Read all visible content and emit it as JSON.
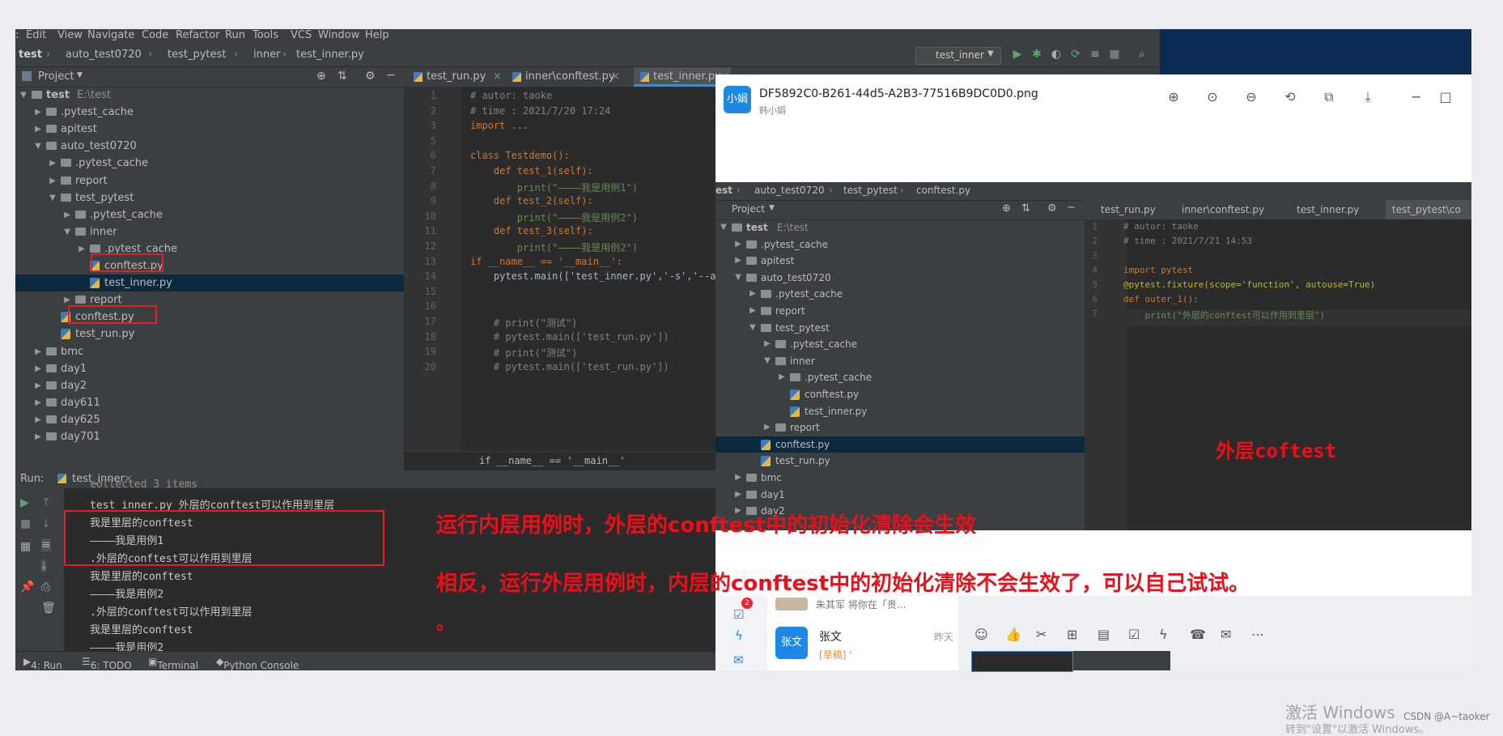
{
  "menu": [
    "Edit",
    "View",
    "Navigate",
    "Code",
    "Refactor",
    "Run",
    "Tools",
    "VCS",
    "Window",
    "Help"
  ],
  "breadcrumb": [
    "test",
    "auto_test0720",
    "test_pytest",
    "inner",
    "test_inner.py"
  ],
  "run_config": "test_inner",
  "project_header": "Project",
  "tree": [
    {
      "label": "test",
      "path": "E:\\test",
      "type": "root"
    },
    {
      "label": ".pytest_cache",
      "type": "folder"
    },
    {
      "label": "apitest",
      "type": "folder"
    },
    {
      "label": "auto_test0720",
      "type": "folder"
    },
    {
      "label": ".pytest_cache",
      "type": "folder"
    },
    {
      "label": "report",
      "type": "folder"
    },
    {
      "label": "test_pytest",
      "type": "folder"
    },
    {
      "label": ".pytest_cache",
      "type": "folder"
    },
    {
      "label": "inner",
      "type": "folder"
    },
    {
      "label": ".pytest_cache",
      "type": "folder"
    },
    {
      "label": "conftest.py",
      "type": "py"
    },
    {
      "label": "test_inner.py",
      "type": "py"
    },
    {
      "label": "report",
      "type": "folder"
    },
    {
      "label": "conftest.py",
      "type": "py"
    },
    {
      "label": "test_run.py",
      "type": "py"
    },
    {
      "label": "bmc",
      "type": "folder"
    },
    {
      "label": "day1",
      "type": "folder"
    },
    {
      "label": "day2",
      "type": "folder"
    },
    {
      "label": "day611",
      "type": "folder"
    },
    {
      "label": "day625",
      "type": "folder"
    },
    {
      "label": "day701",
      "type": "folder"
    }
  ],
  "editor_tabs": [
    "test_run.py",
    "inner\\conftest.py",
    "test_inner.py"
  ],
  "code_lines": [
    {
      "n": "1",
      "t": "# autor: taoke"
    },
    {
      "n": "2",
      "t": "# time : 2021/7/20 17:24"
    },
    {
      "n": "3",
      "t": "import ..."
    },
    {
      "n": "5",
      "t": ""
    },
    {
      "n": "6",
      "t": "class Testdemo():"
    },
    {
      "n": "7",
      "t": "    def test_1(self):"
    },
    {
      "n": "8",
      "t": "        print(\"————我是用例1\")"
    },
    {
      "n": "9",
      "t": "    def test_2(self):"
    },
    {
      "n": "10",
      "t": "        print(\"————我是用例2\")"
    },
    {
      "n": "11",
      "t": "    def test_3(self):"
    },
    {
      "n": "12",
      "t": "        print(\"————我是用例2\")"
    },
    {
      "n": "13",
      "t": "if __name__ == '__main__':"
    },
    {
      "n": "14",
      "t": "    pytest.main(['test_inner.py','-s','--allu"
    },
    {
      "n": "15",
      "t": ""
    },
    {
      "n": "16",
      "t": ""
    },
    {
      "n": "17",
      "t": "    # print(\"测试\")"
    },
    {
      "n": "18",
      "t": "    # pytest.main(['test_run.py'])"
    },
    {
      "n": "19",
      "t": "    # print(\"测试\")"
    },
    {
      "n": "20",
      "t": "    # pytest.main(['test_run.py'])"
    }
  ],
  "editor_footer": "if __name__ == '__main__'",
  "run_label": "Run:",
  "run_tab": "test_inner",
  "output_lines": [
    "collected 3 items",
    "test_inner.py 外层的conftest可以作用到里层",
    "我是里层的conftest",
    "————我是用例1",
    ".外层的conftest可以作用到里层",
    "我是里层的conftest",
    "————我是用例2",
    ".外层的conftest可以作用到里层",
    "我是里层的conftest",
    "————我是用例2"
  ],
  "bottom_tools": [
    "4: Run",
    "6: TODO",
    "Terminal",
    "Python Console"
  ],
  "viewer": {
    "logo": "小娟",
    "filename": "DF5892C0-B261-44d5-A2B3-77516B9DC0D0.png",
    "sender": "韩小娟",
    "icons": [
      "zoom-in-icon",
      "original-size-icon",
      "zoom-out-icon",
      "rotate-icon",
      "copy-icon",
      "download-icon"
    ],
    "inner_breadcrumb": [
      "est",
      "auto_test0720",
      "test_pytest",
      "conftest.py"
    ],
    "inner_tabs": [
      "test_run.py",
      "inner\\conftest.py",
      "test_inner.py",
      "test_pytest\\co"
    ],
    "inner_tree": [
      {
        "label": "test",
        "path": "E:\\test",
        "type": "root"
      },
      {
        "label": ".pytest_cache",
        "type": "folder"
      },
      {
        "label": "apitest",
        "type": "folder"
      },
      {
        "label": "auto_test0720",
        "type": "folder"
      },
      {
        "label": ".pytest_cache",
        "type": "folder"
      },
      {
        "label": "report",
        "type": "folder"
      },
      {
        "label": "test_pytest",
        "type": "folder"
      },
      {
        "label": ".pytest_cache",
        "type": "folder"
      },
      {
        "label": "inner",
        "type": "folder"
      },
      {
        "label": ".pytest_cache",
        "type": "folder"
      },
      {
        "label": "conftest.py",
        "type": "py"
      },
      {
        "label": "test_inner.py",
        "type": "py"
      },
      {
        "label": "report",
        "type": "folder"
      },
      {
        "label": "conftest.py",
        "type": "py"
      },
      {
        "label": "test_run.py",
        "type": "py"
      },
      {
        "label": "bmc",
        "type": "folder"
      },
      {
        "label": "day1",
        "type": "folder"
      },
      {
        "label": "day2",
        "type": "folder"
      }
    ],
    "inner_code": [
      {
        "n": "1",
        "t": "# autor: taoke"
      },
      {
        "n": "2",
        "t": "# time : 2021/7/21 14:53"
      },
      {
        "n": "3",
        "t": ""
      },
      {
        "n": "4",
        "t": "import pytest"
      },
      {
        "n": "5",
        "t": "@pytest.fixture(scope='function', autouse=True)"
      },
      {
        "n": "6",
        "t": "def outer_1():"
      },
      {
        "n": "7",
        "t": "    print(\"外层的conftest可以作用到里层\")"
      }
    ],
    "annotation": "外层coftest"
  },
  "chat": {
    "preview_line": "朱其军 将你在「贵...",
    "contact_avatar": "张文",
    "contact_name": "张文",
    "contact_time": "昨天",
    "contact_draft": "[草稿] '",
    "badge": "2"
  },
  "annotations": {
    "line1": "运行内层用例时，外层的conftest中的初始化清除会生效",
    "line2": "相反，运行外层用例时，内层的conftest中的初始化清除不会生效了，可以自己试试。",
    "line3": "。"
  },
  "watermark": {
    "activate": "激活 Windows",
    "activate_sub": "转到\"设置\"以激活 Windows。",
    "credit": "CSDN @A~taoker"
  },
  "colors": {
    "ide_bg": "#3c3f41",
    "editor_bg": "#2b2b2b",
    "annotation_red": "#e8101a",
    "selection": "#0d293e"
  }
}
